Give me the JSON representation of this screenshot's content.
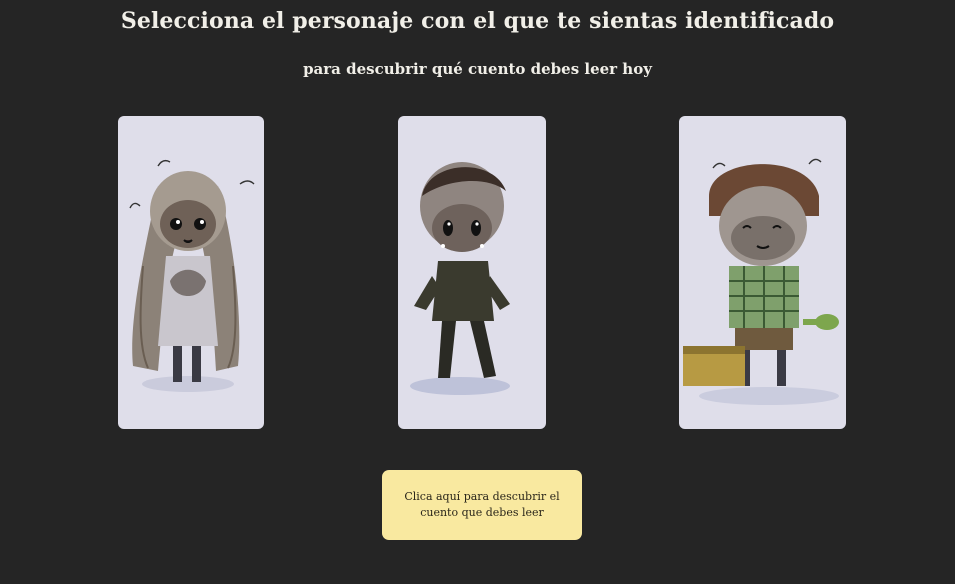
{
  "header": {
    "title": "Selecciona el personaje con el que te sientas identificado",
    "subtitle": "para descubrir qué cuento debes leer hoy"
  },
  "characters": [
    {
      "name": "girl-long-hair-illustration"
    },
    {
      "name": "boy-dark-clothes-illustration"
    },
    {
      "name": "boy-plaid-shirt-suitcase-illustration"
    }
  ],
  "cta": {
    "label": "Clica aquí para descubrir el cuento que debes leer",
    "color": "#f9e9a0"
  },
  "colors": {
    "background": "#252525",
    "card_background": "#dfdeea",
    "text": "#f1efe8"
  }
}
